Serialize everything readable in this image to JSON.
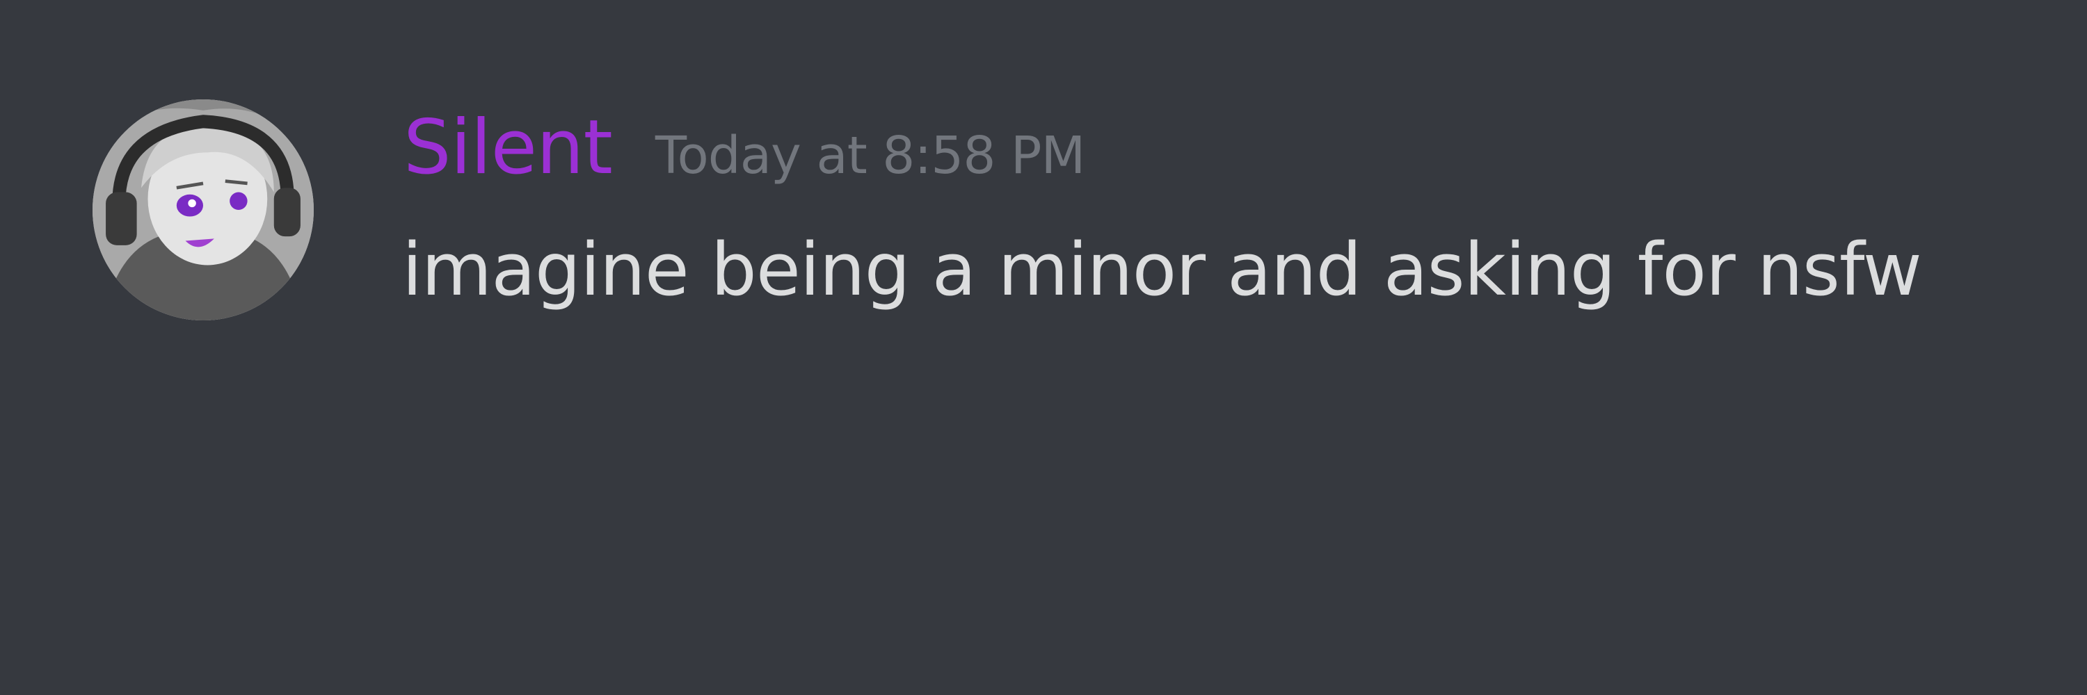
{
  "message": {
    "username": "Silent",
    "timestamp": "Today at 8:58 PM",
    "content": "imagine being a minor and asking for nsfw",
    "username_color": "#9b30d4",
    "avatar_icon": "user-avatar-headphones"
  },
  "colors": {
    "background": "#36393f",
    "text": "#dcddde",
    "timestamp": "#72767d"
  }
}
